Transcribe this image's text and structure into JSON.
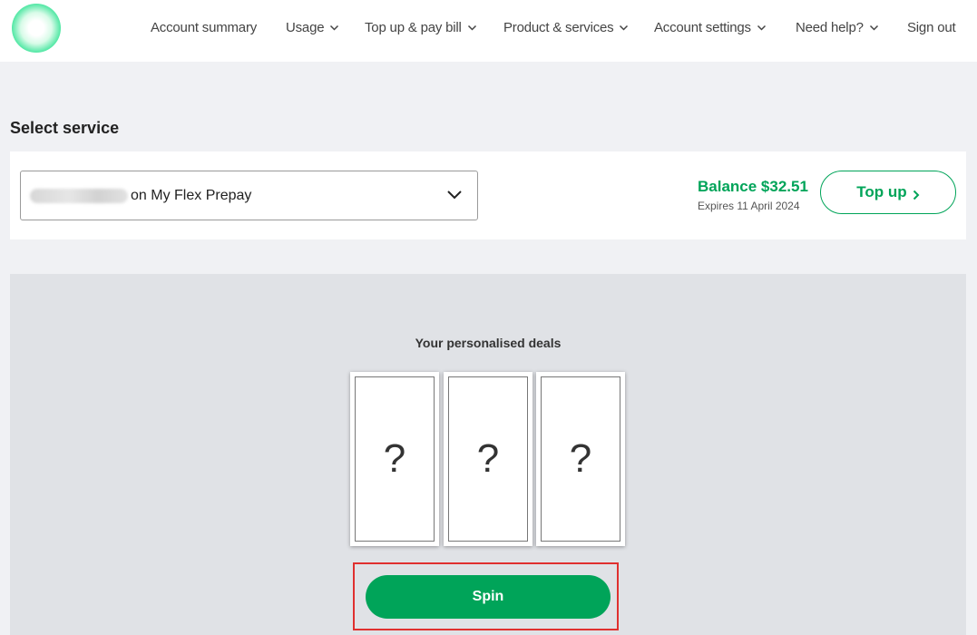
{
  "nav": {
    "items": [
      {
        "label": "Account summary",
        "dropdown": false
      },
      {
        "label": "Usage",
        "dropdown": true
      },
      {
        "label": "Top up & pay bill",
        "dropdown": true
      },
      {
        "label": "Product & services",
        "dropdown": true
      },
      {
        "label": "Account settings",
        "dropdown": true
      },
      {
        "label": "Need help?",
        "dropdown": true
      },
      {
        "label": "Sign out",
        "dropdown": false
      }
    ]
  },
  "service": {
    "section_title": "Select service",
    "selected_plan": "on My Flex Prepay",
    "balance": "Balance $32.51",
    "expires": "Expires 11 April 2024",
    "topup_label": "Top up"
  },
  "deals": {
    "title": "Your personalised deals",
    "cards": [
      "?",
      "?",
      "?"
    ],
    "spin_label": "Spin"
  },
  "colors": {
    "brand_green": "#00a459",
    "highlight_red": "#e0302f",
    "page_bg": "#f0f1f4",
    "panel_bg": "#e0e2e6"
  },
  "icons": [
    "logo",
    "chevron-down-icon",
    "chevron-right-icon"
  ]
}
